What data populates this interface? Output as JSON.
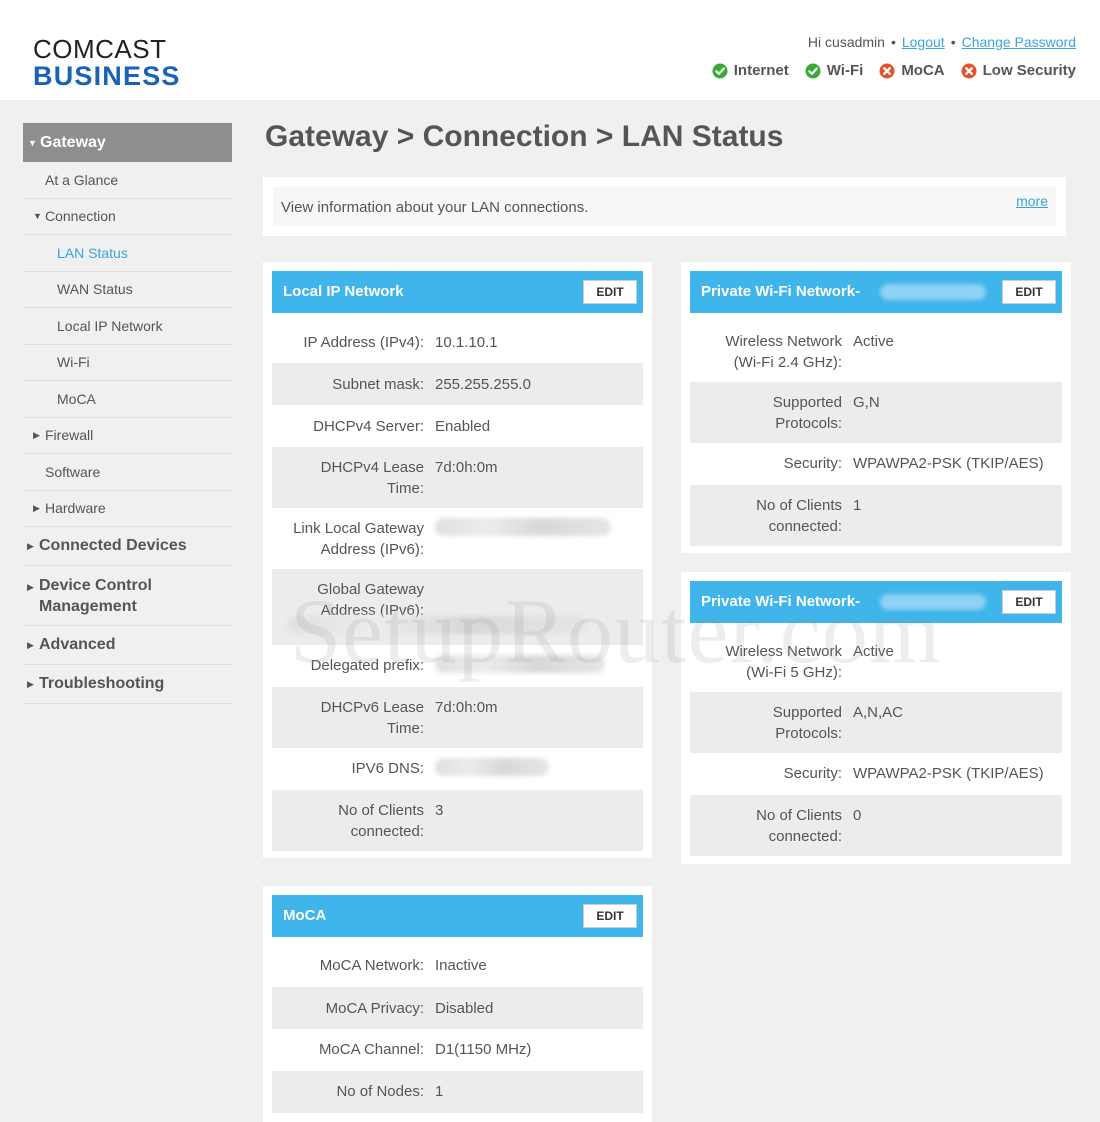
{
  "logo": {
    "line1": "COMCAST",
    "line2": "BUSINESS"
  },
  "header": {
    "greeting": "Hi cusadmin",
    "separator": "•",
    "logout": "Logout",
    "change_password": "Change Password",
    "status": [
      {
        "label": "Internet",
        "state": "ok",
        "color": "#3aaa35"
      },
      {
        "label": "Wi-Fi",
        "state": "ok",
        "color": "#3aaa35"
      },
      {
        "label": "MoCA",
        "state": "error",
        "color": "#e4532f"
      },
      {
        "label": "Low Security",
        "state": "error",
        "color": "#e4532f"
      }
    ]
  },
  "sidebar": {
    "gateway": "Gateway",
    "items": [
      {
        "label": "At a Glance"
      },
      {
        "label": "Connection"
      },
      {
        "label": "LAN Status"
      },
      {
        "label": "WAN Status"
      },
      {
        "label": "Local IP Network"
      },
      {
        "label": "Wi-Fi"
      },
      {
        "label": "MoCA"
      },
      {
        "label": "Firewall"
      },
      {
        "label": "Software"
      },
      {
        "label": "Hardware"
      }
    ],
    "top_items": [
      {
        "label": "Connected Devices"
      },
      {
        "label": "Device Control",
        "label2": "Management"
      },
      {
        "label": "Advanced"
      },
      {
        "label": "Troubleshooting"
      }
    ]
  },
  "page": {
    "title": "Gateway > Connection > LAN Status",
    "intro": "View information about your LAN connections.",
    "more": "more"
  },
  "local_ip": {
    "title": "Local IP Network",
    "edit": "EDIT",
    "rows": [
      {
        "label": "IP Address (IPv4):",
        "value": "10.1.10.1"
      },
      {
        "label": "Subnet mask:",
        "value": "255.255.255.0"
      },
      {
        "label": "DHCPv4 Server:",
        "value": "Enabled"
      },
      {
        "label": "DHCPv4 Lease",
        "label2": "Time:",
        "value": "7d:0h:0m"
      },
      {
        "label": "Link Local Gateway",
        "label2": "Address (IPv6):",
        "value": ""
      },
      {
        "label": "Global Gateway",
        "label2": "Address (IPv6):",
        "value": ""
      },
      {
        "label": "Delegated prefix:",
        "value": ""
      },
      {
        "label": "DHCPv6 Lease",
        "label2": "Time:",
        "value": "7d:0h:0m"
      },
      {
        "label": "IPV6 DNS:",
        "value": ""
      },
      {
        "label": "No of Clients",
        "label2": "connected:",
        "value": "3"
      }
    ]
  },
  "wifi24": {
    "title": "Private Wi-Fi Network-",
    "edit": "EDIT",
    "rows": [
      {
        "label": "Wireless Network",
        "label2": "(Wi-Fi 2.4 GHz):",
        "value": "Active"
      },
      {
        "label": "Supported",
        "label2": "Protocols:",
        "value": "G,N"
      },
      {
        "label": "Security:",
        "value": "WPAWPA2-PSK (TKIP/AES)"
      },
      {
        "label": "No of Clients",
        "label2": "connected:",
        "value": "1"
      }
    ]
  },
  "wifi5": {
    "title": "Private Wi-Fi Network-",
    "edit": "EDIT",
    "rows": [
      {
        "label": "Wireless Network",
        "label2": "(Wi-Fi 5 GHz):",
        "value": "Active"
      },
      {
        "label": "Supported",
        "label2": "Protocols:",
        "value": "A,N,AC"
      },
      {
        "label": "Security:",
        "value": "WPAWPA2-PSK (TKIP/AES)"
      },
      {
        "label": "No of Clients",
        "label2": "connected:",
        "value": "0"
      }
    ]
  },
  "moca": {
    "title": "MoCA",
    "edit": "EDIT",
    "rows": [
      {
        "label": "MoCA Network:",
        "value": "Inactive"
      },
      {
        "label": "MoCA Privacy:",
        "value": "Disabled"
      },
      {
        "label": "MoCA Channel:",
        "value": "D1(1150 MHz)"
      },
      {
        "label": "No of Nodes:",
        "value": "1"
      }
    ]
  },
  "watermark": "SetupRouter.com"
}
